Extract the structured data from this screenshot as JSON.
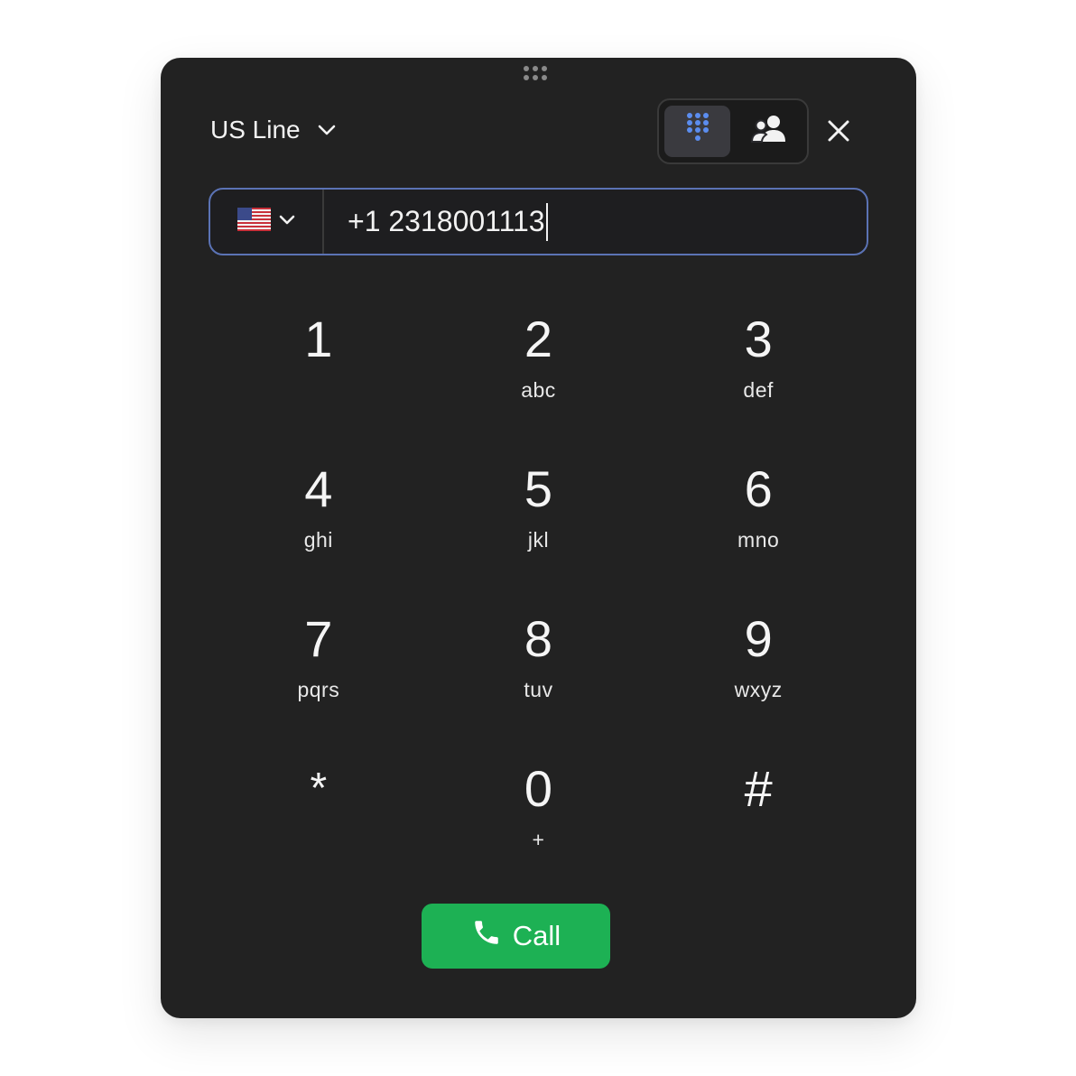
{
  "header": {
    "line_label": "US Line"
  },
  "view_toggle": {
    "keypad_icon": "dialpad-icon",
    "contacts_icon": "contacts-icon",
    "active": "keypad",
    "active_color": "#5b8def"
  },
  "phone": {
    "country_flag": "us-flag-icon",
    "number": "+1 2318001113"
  },
  "keypad": [
    {
      "digit": "1",
      "letters": ""
    },
    {
      "digit": "2",
      "letters": "abc"
    },
    {
      "digit": "3",
      "letters": "def"
    },
    {
      "digit": "4",
      "letters": "ghi"
    },
    {
      "digit": "5",
      "letters": "jkl"
    },
    {
      "digit": "6",
      "letters": "mno"
    },
    {
      "digit": "7",
      "letters": "pqrs"
    },
    {
      "digit": "8",
      "letters": "tuv"
    },
    {
      "digit": "9",
      "letters": "wxyz"
    },
    {
      "digit": "*",
      "letters": ""
    },
    {
      "digit": "0",
      "letters": "+"
    },
    {
      "digit": "#",
      "letters": ""
    }
  ],
  "call": {
    "label": "Call",
    "color": "#1db154"
  },
  "colors": {
    "panel_bg": "#222222",
    "field_border": "#5b73b5"
  }
}
